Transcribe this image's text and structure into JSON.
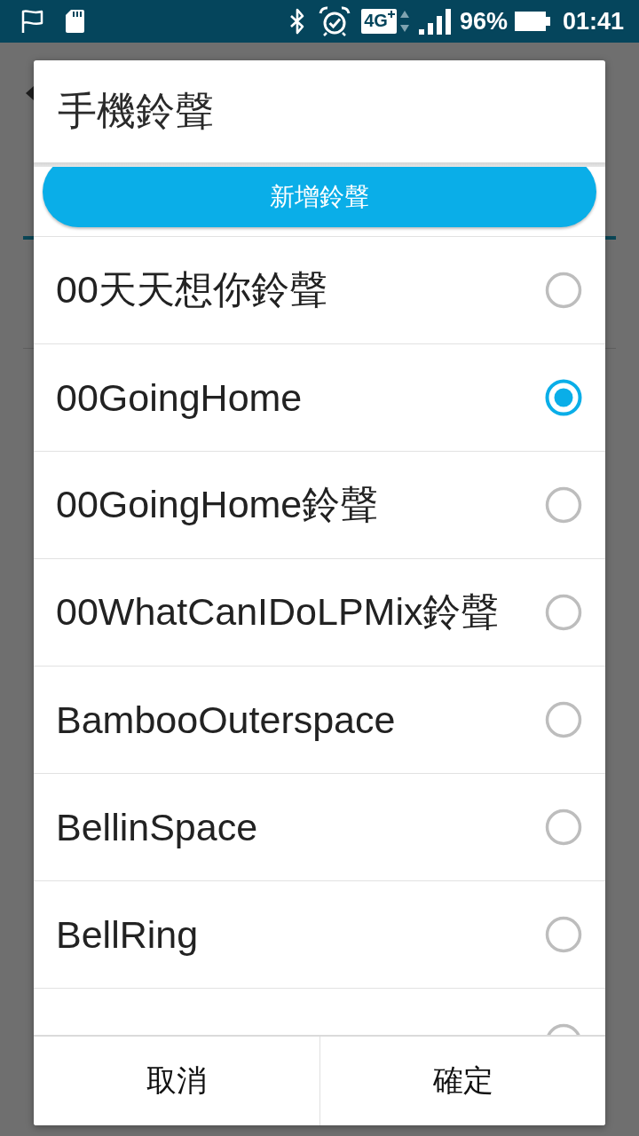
{
  "status_bar": {
    "network_type": "4G",
    "battery": "96%",
    "time": "01:41"
  },
  "dialog": {
    "title": "手機鈴聲",
    "add_button": "新增鈴聲",
    "ringtones": [
      {
        "name": "00天天想你鈴聲",
        "selected": false
      },
      {
        "name": "00GoingHome",
        "selected": true
      },
      {
        "name": "00GoingHome鈴聲",
        "selected": false
      },
      {
        "name": "00WhatCanIDoLPMix鈴聲",
        "selected": false
      },
      {
        "name": "BambooOuterspace",
        "selected": false
      },
      {
        "name": "BellinSpace",
        "selected": false
      },
      {
        "name": "BellRing",
        "selected": false
      },
      {
        "selected": false
      }
    ],
    "buttons": [
      "取消",
      "確定"
    ]
  }
}
